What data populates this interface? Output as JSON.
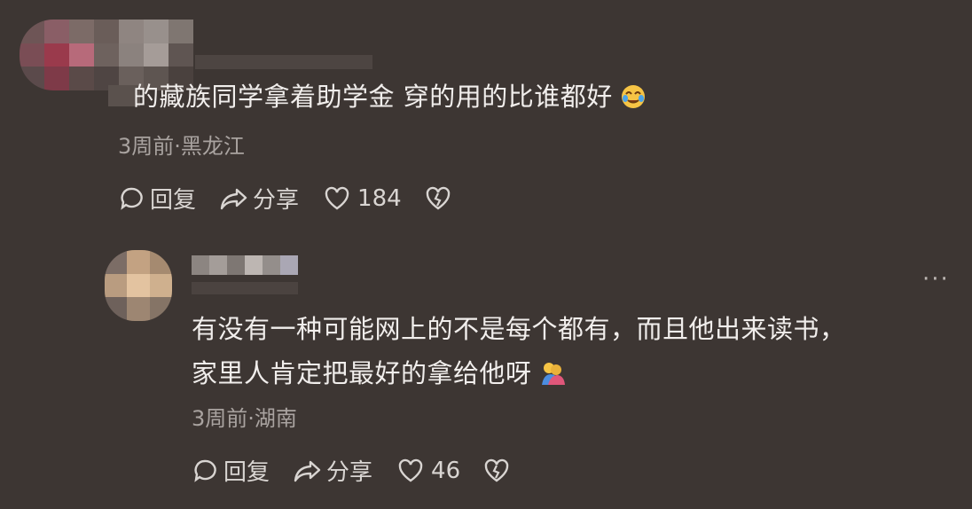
{
  "comments": [
    {
      "text": "的藏族同学拿着助学金 穿的用的比谁都好",
      "emoji": "smiling-face-with-tear",
      "meta": "3周前·黑龙江",
      "reply_label": "回复",
      "share_label": "分享",
      "like_count": "184"
    },
    {
      "text_line1": "有没有一种可能网上的不是每个都有，而且他出来读书，",
      "text_line2": "家里人肯定把最好的拿给他呀",
      "emoji": "hugging-people",
      "meta": "3周前·湖南",
      "reply_label": "回复",
      "share_label": "分享",
      "like_count": "46",
      "more_label": "···"
    }
  ],
  "colors": {
    "background": "#3d3633",
    "text": "#f1eeec",
    "meta": "#a9a3a0"
  }
}
